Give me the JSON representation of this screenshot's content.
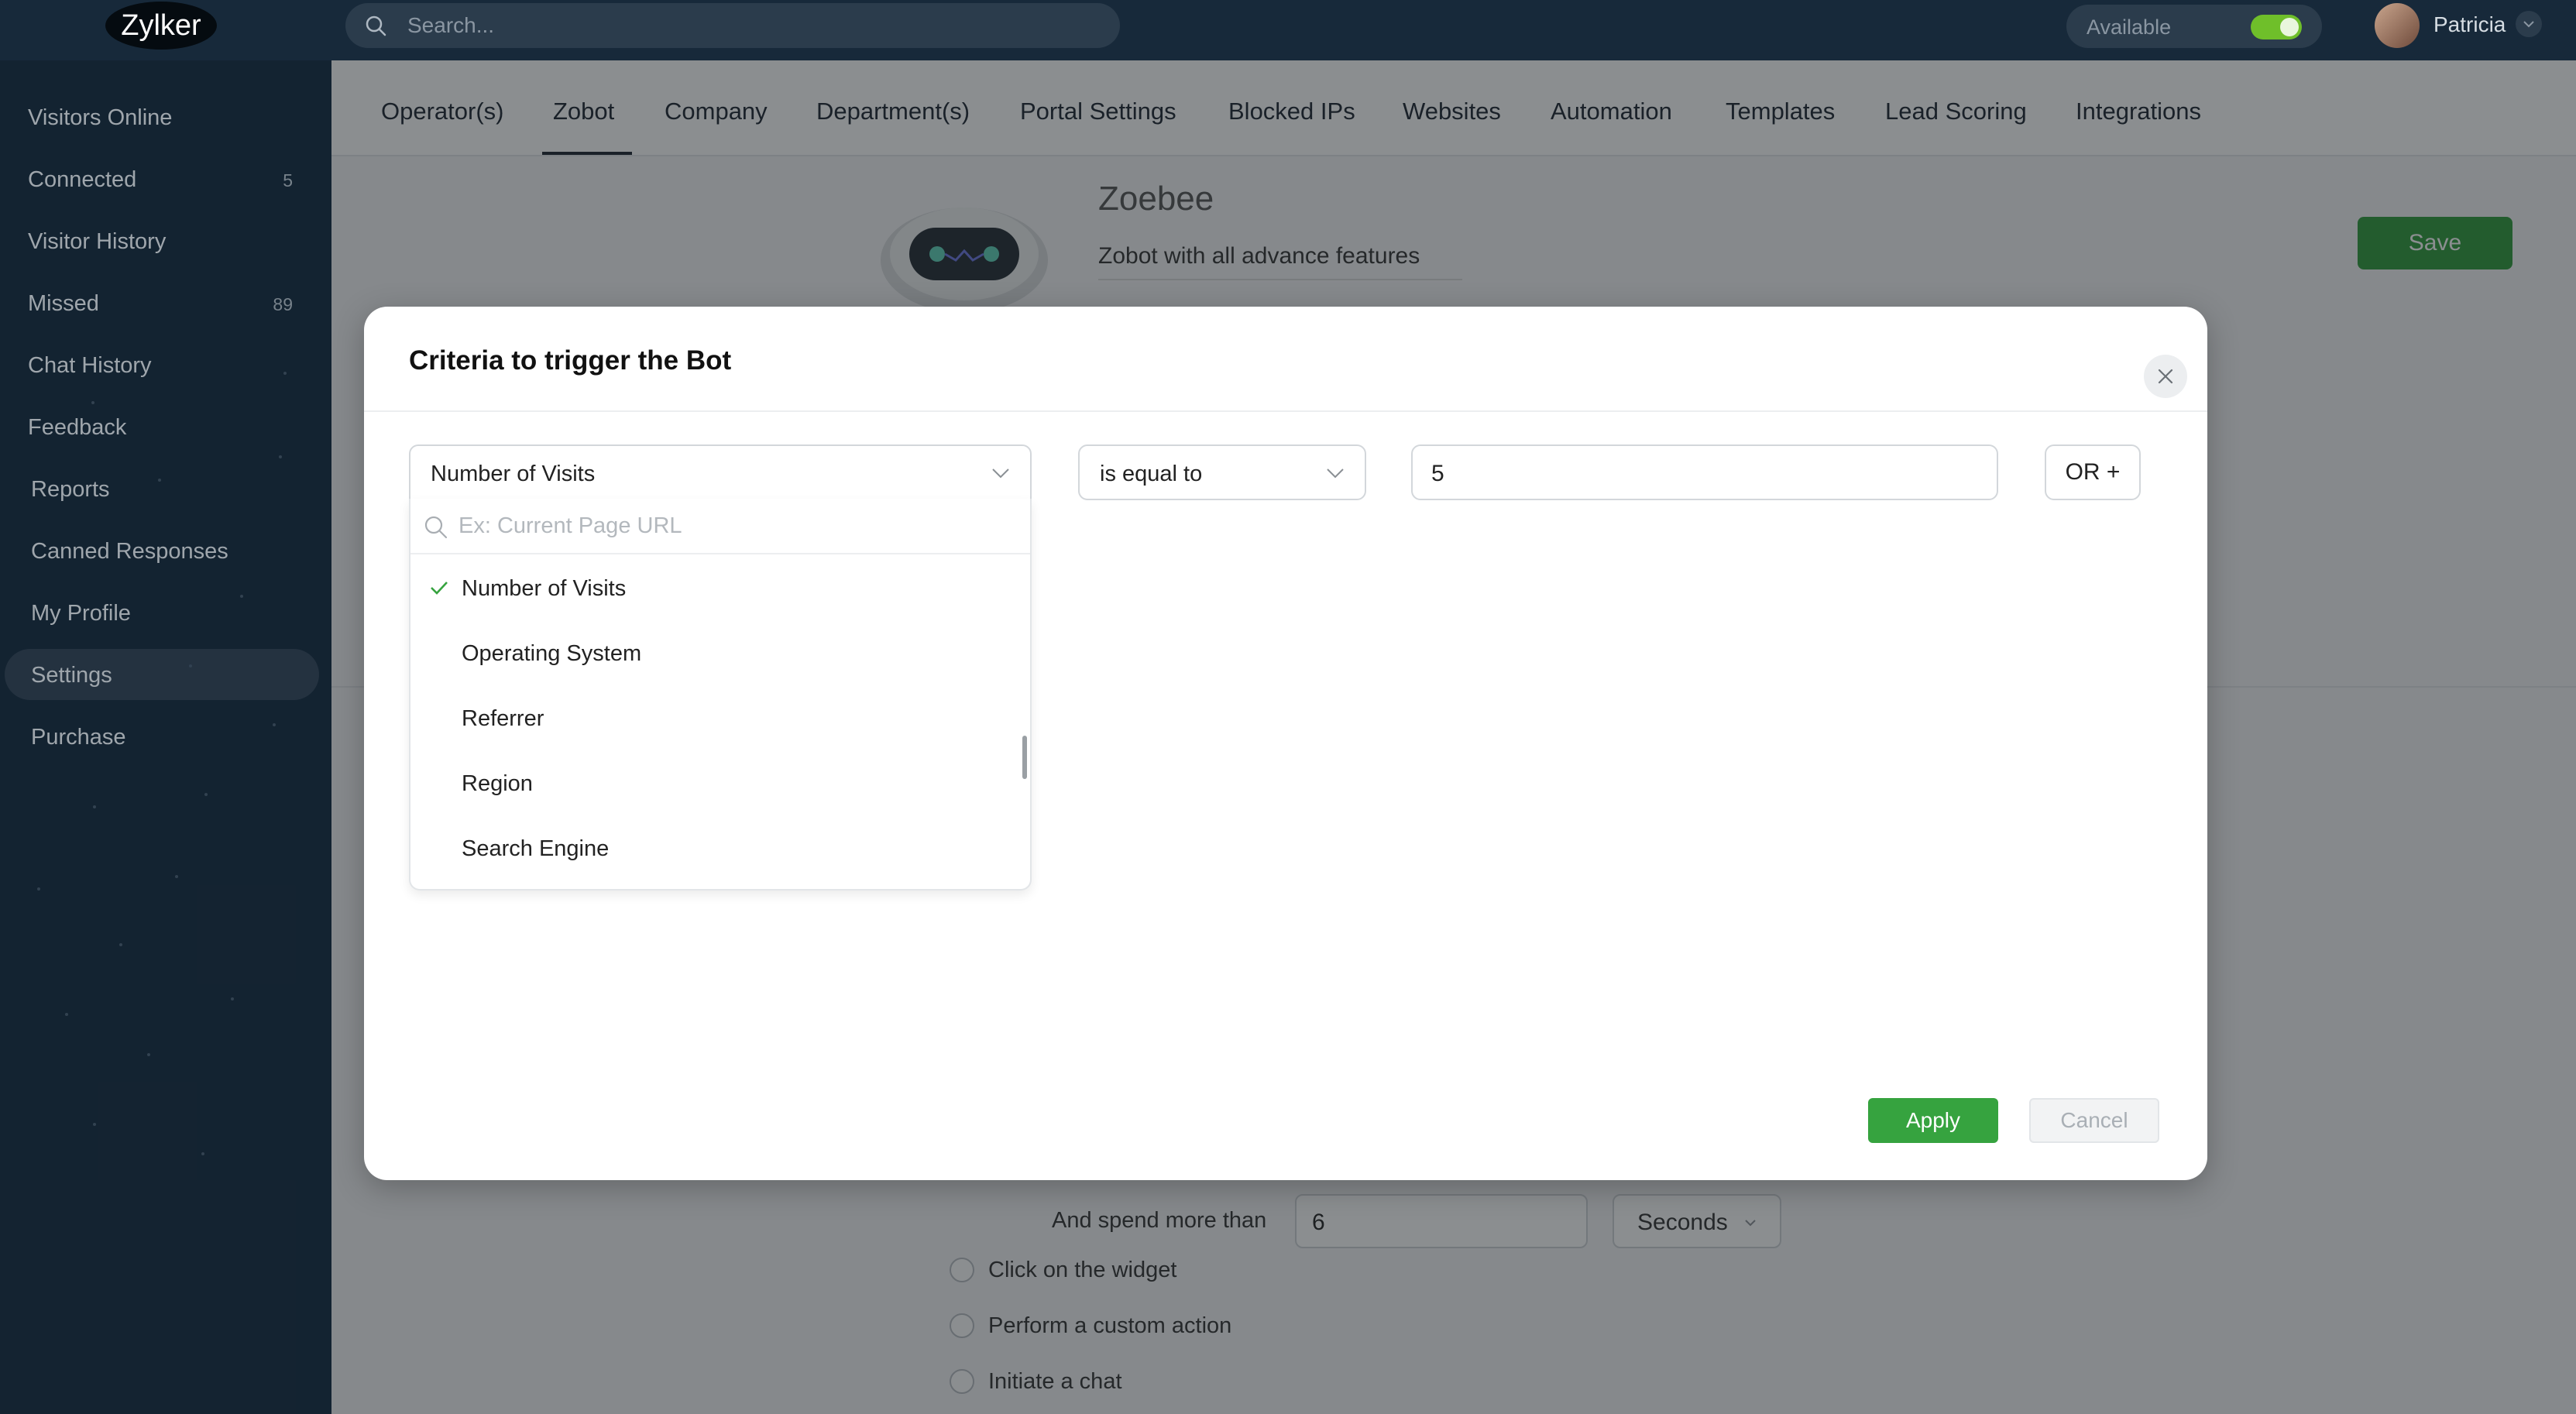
{
  "app": {
    "logo_text": "Zylker"
  },
  "topbar": {
    "search_placeholder": "Search...",
    "status_label": "Available",
    "status_on": true,
    "user_name": "Patricia"
  },
  "sidebar": {
    "items": [
      {
        "label": "Visitors Online",
        "count": ""
      },
      {
        "label": "Connected",
        "count": "5"
      },
      {
        "label": "Visitor History",
        "count": ""
      },
      {
        "label": "Missed",
        "count": "89"
      },
      {
        "label": "Chat History",
        "count": ""
      },
      {
        "label": "Feedback",
        "count": ""
      },
      {
        "label": "Reports",
        "count": ""
      },
      {
        "label": "Canned Responses",
        "count": ""
      },
      {
        "label": "My Profile",
        "count": ""
      },
      {
        "label": "Settings",
        "count": "",
        "active": true
      },
      {
        "label": "Purchase",
        "count": ""
      }
    ]
  },
  "tabs": [
    {
      "label": "Operator(s)"
    },
    {
      "label": "Zobot",
      "active": true
    },
    {
      "label": "Company"
    },
    {
      "label": "Department(s)"
    },
    {
      "label": "Portal Settings"
    },
    {
      "label": "Blocked IPs"
    },
    {
      "label": "Websites"
    },
    {
      "label": "Automation"
    },
    {
      "label": "Templates"
    },
    {
      "label": "Lead Scoring"
    },
    {
      "label": "Integrations"
    }
  ],
  "bot": {
    "name": "Zoebee",
    "description": "Zobot with all advance features",
    "save_label": "Save"
  },
  "trigger": {
    "spend_label": "And spend more than",
    "spend_value": "6",
    "unit": "Seconds",
    "options": [
      {
        "label": "Click on the widget"
      },
      {
        "label": "Perform a custom action"
      },
      {
        "label": "Initiate a chat"
      }
    ]
  },
  "modal": {
    "title": "Criteria to trigger the Bot",
    "criteria_field": "Number of Visits",
    "condition": "is equal to",
    "value": "5",
    "or_label": "OR +",
    "apply_label": "Apply",
    "cancel_label": "Cancel",
    "dropdown": {
      "search_placeholder": "Ex: Current Page URL",
      "options": [
        {
          "label": "Number of Visits",
          "selected": true
        },
        {
          "label": "Operating System"
        },
        {
          "label": "Referrer"
        },
        {
          "label": "Region"
        },
        {
          "label": "Search Engine"
        }
      ]
    }
  },
  "colors": {
    "sidebar_bg": "#17293a",
    "accent_green": "#36a33f",
    "save_green": "#2f9a3b",
    "toggle_green": "#6fbf2a"
  }
}
